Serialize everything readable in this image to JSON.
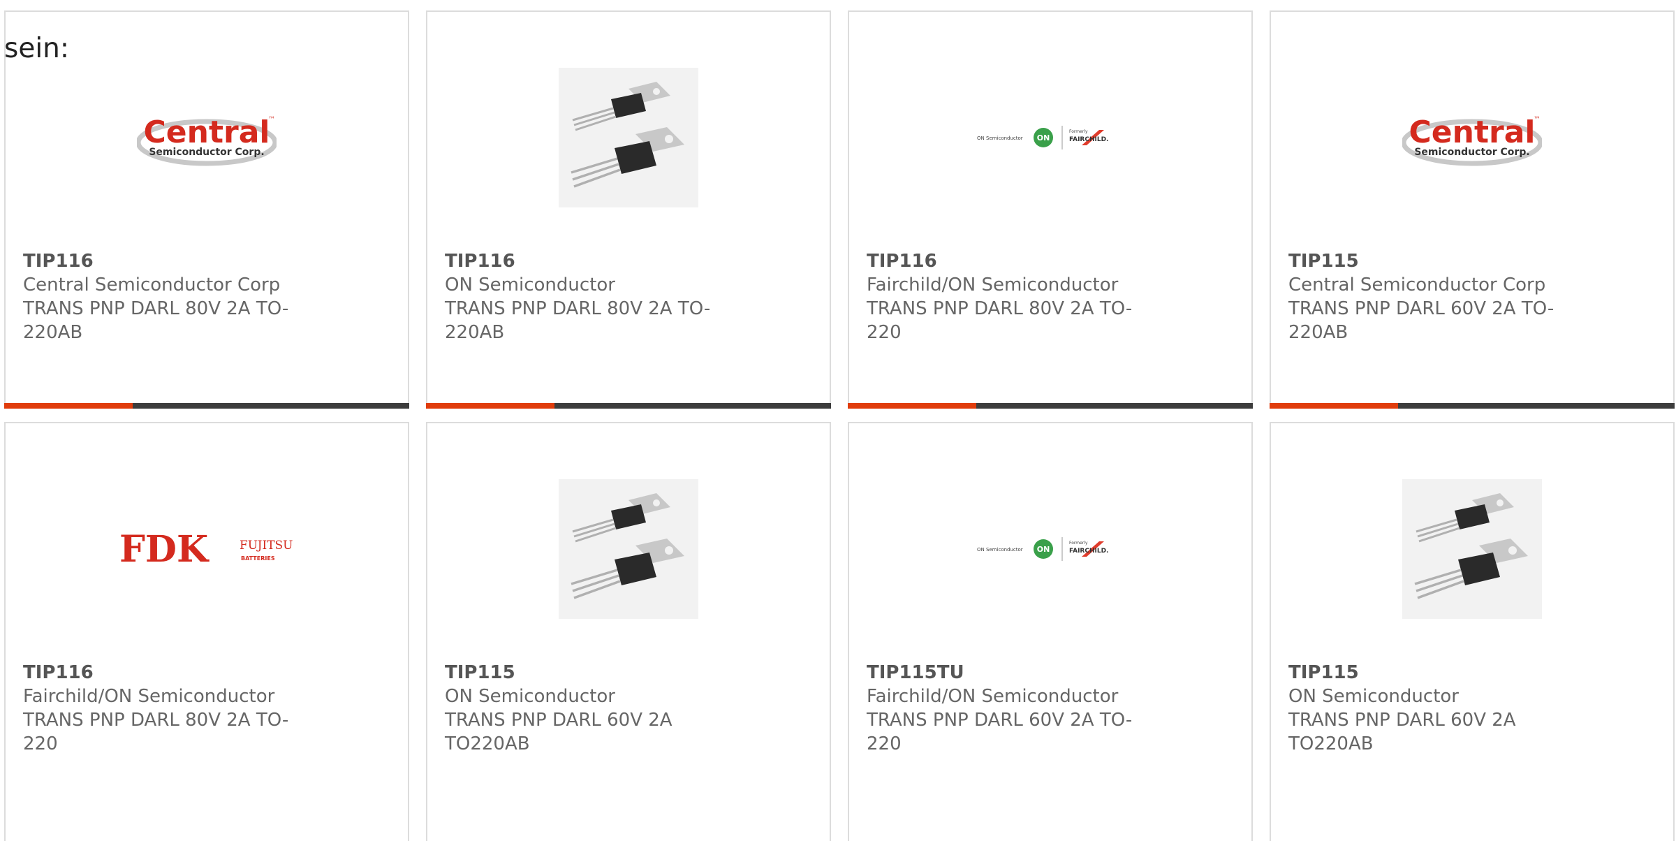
{
  "intro_text": "sein:",
  "colors": {
    "accent": "#e03c0c",
    "bar": "#3c3c3c",
    "card_border": "#dcdcdc",
    "text": "#666666"
  },
  "products": [
    {
      "part": "TIP116",
      "manufacturer": "Central Semiconductor Corp",
      "description": "TRANS PNP DARL 80V 2A TO-220AB",
      "image": "central-semiconductor-logo"
    },
    {
      "part": "TIP116",
      "manufacturer": "ON Semiconductor",
      "description": "TRANS PNP DARL 80V 2A TO-220AB",
      "image": "to220-transistor-photo"
    },
    {
      "part": "TIP116",
      "manufacturer": "Fairchild/ON Semiconductor",
      "description": "TRANS PNP DARL 80V 2A TO-220",
      "image": "on-fairchild-logo"
    },
    {
      "part": "TIP115",
      "manufacturer": "Central Semiconductor Corp",
      "description": "TRANS PNP DARL 60V 2A TO-220AB",
      "image": "central-semiconductor-logo"
    },
    {
      "part": "TIP116",
      "manufacturer": "Fairchild/ON Semiconductor",
      "description": "TRANS PNP DARL 80V 2A TO-220",
      "image": "fdk-fujitsu-logo"
    },
    {
      "part": "TIP115",
      "manufacturer": "ON Semiconductor",
      "description": "TRANS PNP DARL 60V 2A TO220AB",
      "image": "to220-transistor-photo"
    },
    {
      "part": "TIP115TU",
      "manufacturer": "Fairchild/ON Semiconductor",
      "description": "TRANS PNP DARL 60V 2A TO-220",
      "image": "on-fairchild-logo"
    },
    {
      "part": "TIP115",
      "manufacturer": "ON Semiconductor",
      "description": "TRANS PNP DARL 60V 2A TO220AB",
      "image": "to220-transistor-photo"
    }
  ],
  "logos": {
    "central_main": "Central",
    "central_sub": "Semiconductor Corp.",
    "central_tm": "™",
    "on_left": "ON Semiconductor",
    "on_badge": "ON",
    "fairchild_formerly": "Formerly",
    "fairchild_name": "FAIRCHILD.",
    "fdk_main": "FDK",
    "fdk_brand": "FUJITSU",
    "fdk_sub": "BATTERIES"
  }
}
